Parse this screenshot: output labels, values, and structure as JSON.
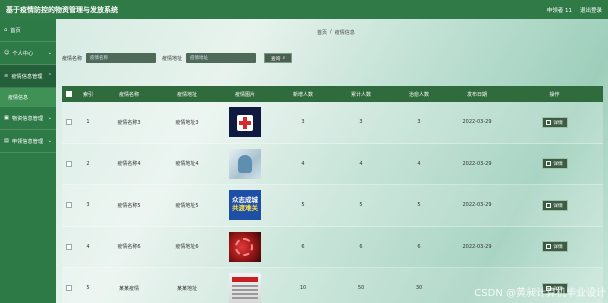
{
  "app": {
    "title": "基于疫情防控的物资管理与发放系统",
    "user_label": "申领者 11",
    "logout_label": "退出登录"
  },
  "sidebar": {
    "items": [
      {
        "label": "首页",
        "icon": "home-icon"
      },
      {
        "label": "个人中心",
        "icon": "user-icon"
      },
      {
        "label": "疫情信息管理",
        "icon": "list-icon"
      },
      {
        "label": "疫情信息",
        "icon": ""
      },
      {
        "label": "物资信息管理",
        "icon": "box-icon"
      },
      {
        "label": "申领信息管理",
        "icon": "doc-icon"
      }
    ]
  },
  "breadcrumb": {
    "home": "首页",
    "sep": "/",
    "current": "疫情信息"
  },
  "search": {
    "name_label": "疫情名称",
    "name_placeholder": "疫情名称",
    "addr_label": "疫情地址",
    "addr_placeholder": "疫情地址",
    "button_label": "查询"
  },
  "table": {
    "headers": [
      "索引",
      "疫情名称",
      "疫情地址",
      "疫情图片",
      "新增人数",
      "累计人数",
      "治愈人数",
      "发布日期",
      "操作"
    ],
    "rows": [
      {
        "idx": "1",
        "name": "疫情名称3",
        "addr": "疫情地址3",
        "img": "first-aid-image",
        "n1": "3",
        "n2": "3",
        "n3": "3",
        "date": "2022-03-29",
        "op": "详情"
      },
      {
        "idx": "2",
        "name": "疫情名称4",
        "addr": "疫情地址4",
        "img": "medical-worker-image",
        "n1": "4",
        "n2": "4",
        "n3": "4",
        "date": "2022-03-29",
        "op": "详情"
      },
      {
        "idx": "3",
        "name": "疫情名称5",
        "addr": "疫情地址5",
        "img": "poster-image",
        "n1": "5",
        "n2": "5",
        "n3": "5",
        "date": "2022-03-29",
        "op": "详情"
      },
      {
        "idx": "4",
        "name": "疫情名称6",
        "addr": "疫情地址6",
        "img": "virus-image",
        "n1": "6",
        "n2": "6",
        "n3": "6",
        "date": "2022-03-29",
        "op": "详情"
      },
      {
        "idx": "5",
        "name": "某某疫情",
        "addr": "某某地址",
        "img": "news-image",
        "n1": "10",
        "n2": "50",
        "n3": "30",
        "date": "",
        "op": "详情"
      }
    ]
  },
  "poster_text": {
    "top": "众志成城",
    "bottom": "共渡难关"
  },
  "watermark": "CSDN @黄昶计算机毕业设计",
  "colors": {
    "topbar": "#2f7a47",
    "sidebar": "#2e7a47",
    "table_header": "#2f6b3c",
    "button": "#3c5d44"
  }
}
